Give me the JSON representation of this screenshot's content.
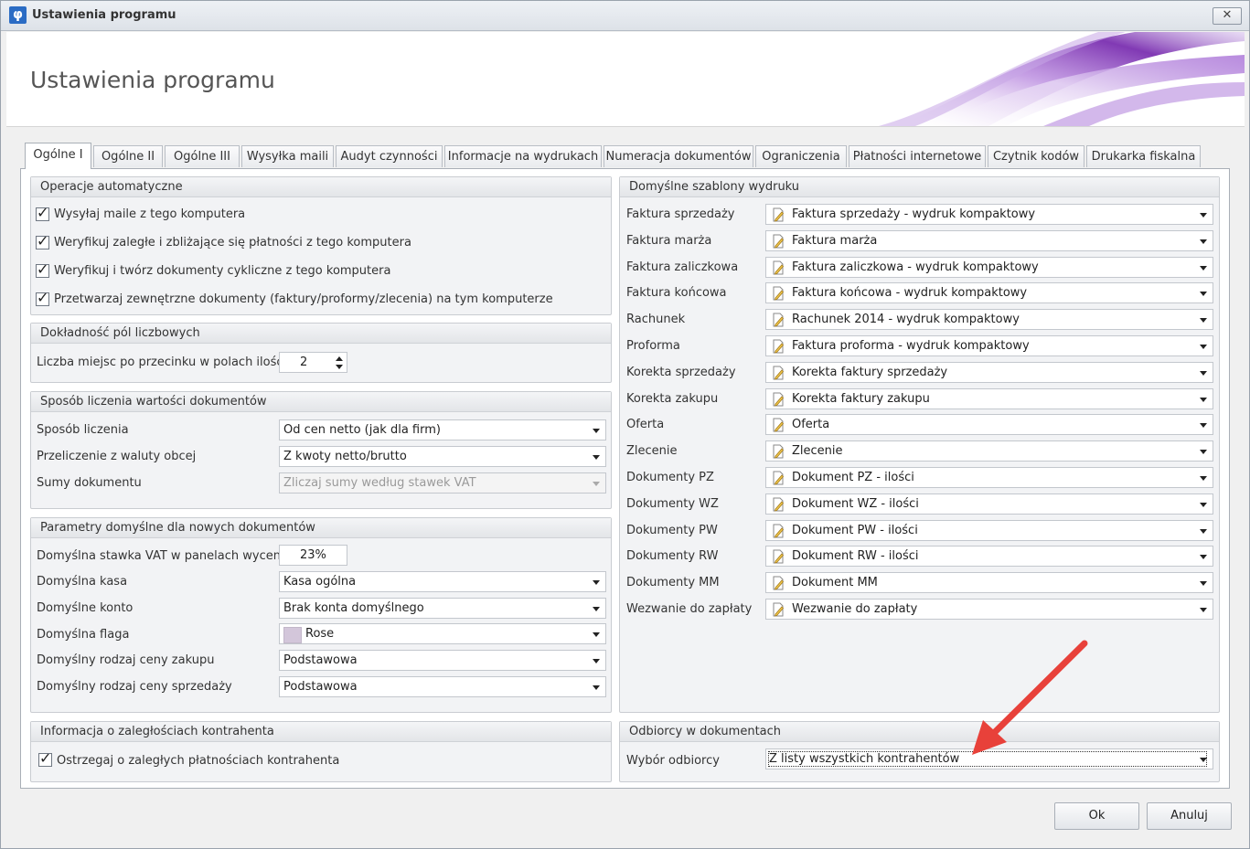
{
  "window": {
    "title": "Ustawienia programu",
    "close_label": "✕"
  },
  "banner": {
    "title": "Ustawienia programu"
  },
  "tabs": [
    {
      "label": "Ogólne I"
    },
    {
      "label": "Ogólne II"
    },
    {
      "label": "Ogólne III"
    },
    {
      "label": "Wysyłka maili"
    },
    {
      "label": "Audyt czynności"
    },
    {
      "label": "Informacje na wydrukach"
    },
    {
      "label": "Numeracja dokumentów"
    },
    {
      "label": "Ograniczenia"
    },
    {
      "label": "Płatności internetowe"
    },
    {
      "label": "Czytnik kodów"
    },
    {
      "label": "Drukarka fiskalna"
    }
  ],
  "auto_ops": {
    "title": "Operacje automatyczne",
    "items": [
      {
        "label": "Wysyłaj maile z tego komputera",
        "checked": true
      },
      {
        "label": "Weryfikuj zaległe i zbliżające się płatności z tego komputera",
        "checked": true
      },
      {
        "label": "Weryfikuj i twórz dokumenty cykliczne z tego komputera",
        "checked": true
      },
      {
        "label": "Przetwarzaj zewnętrzne dokumenty (faktury/proformy/zlecenia) na tym komputerze",
        "checked": true
      }
    ]
  },
  "precision": {
    "title": "Dokładność pól liczbowych",
    "label": "Liczba miejsc po przecinku w polach ilości",
    "value": "2"
  },
  "calc": {
    "title": "Sposób liczenia wartości dokumentów",
    "rows": [
      {
        "label": "Sposób liczenia",
        "value": "Od cen netto (jak dla firm)"
      },
      {
        "label": "Przeliczenie z waluty obcej",
        "value": "Z kwoty netto/brutto"
      },
      {
        "label": "Sumy dokumentu",
        "value": "Zliczaj sumy według stawek VAT"
      }
    ]
  },
  "defaults": {
    "title": "Parametry domyślne dla nowych dokumentów",
    "vat_label": "Domyślna stawka VAT w panelach wycen",
    "vat_value": "23%",
    "rows": [
      {
        "label": "Domyślna kasa",
        "value": "Kasa ogólna"
      },
      {
        "label": "Domyślne konto",
        "value": "Brak konta domyślnego"
      },
      {
        "label": "Domyślna flaga",
        "value": "Rose",
        "color": "#d3c6da"
      },
      {
        "label": "Domyślny rodzaj ceny zakupu",
        "value": "Podstawowa"
      },
      {
        "label": "Domyślny rodzaj ceny sprzedaży",
        "value": "Podstawowa"
      }
    ]
  },
  "overdue": {
    "title": "Informacja o zaległościach kontrahenta",
    "label": "Ostrzegaj o zaległych płatnościach kontrahenta",
    "checked": true
  },
  "templates": {
    "title": "Domyślne szablony wydruku",
    "rows": [
      {
        "label": "Faktura sprzedaży",
        "value": "Faktura sprzedaży - wydruk kompaktowy"
      },
      {
        "label": "Faktura marża",
        "value": "Faktura marża"
      },
      {
        "label": "Faktura zaliczkowa",
        "value": "Faktura zaliczkowa - wydruk kompaktowy"
      },
      {
        "label": "Faktura końcowa",
        "value": "Faktura końcowa - wydruk kompaktowy"
      },
      {
        "label": "Rachunek",
        "value": "Rachunek 2014 - wydruk kompaktowy"
      },
      {
        "label": "Proforma",
        "value": "Faktura proforma - wydruk kompaktowy"
      },
      {
        "label": "Korekta sprzedaży",
        "value": "Korekta faktury sprzedaży"
      },
      {
        "label": "Korekta zakupu",
        "value": "Korekta faktury zakupu"
      },
      {
        "label": "Oferta",
        "value": "Oferta"
      },
      {
        "label": "Zlecenie",
        "value": "Zlecenie"
      },
      {
        "label": "Dokumenty PZ",
        "value": "Dokument PZ - ilości"
      },
      {
        "label": "Dokumenty WZ",
        "value": "Dokument WZ - ilości"
      },
      {
        "label": "Dokumenty PW",
        "value": "Dokument PW - ilości"
      },
      {
        "label": "Dokumenty RW",
        "value": "Dokument RW - ilości"
      },
      {
        "label": "Dokumenty MM",
        "value": "Dokument MM"
      },
      {
        "label": "Wezwanie do zapłaty",
        "value": "Wezwanie do zapłaty"
      }
    ]
  },
  "recipients": {
    "title": "Odbiorcy w dokumentach",
    "label": "Wybór odbiorcy",
    "value": "Z listy wszystkich kontrahentów"
  },
  "buttons": {
    "ok": "Ok",
    "cancel": "Anuluj"
  },
  "colors": {
    "arrow": "#e8413a",
    "banner_accent": "#8a3fc0"
  }
}
